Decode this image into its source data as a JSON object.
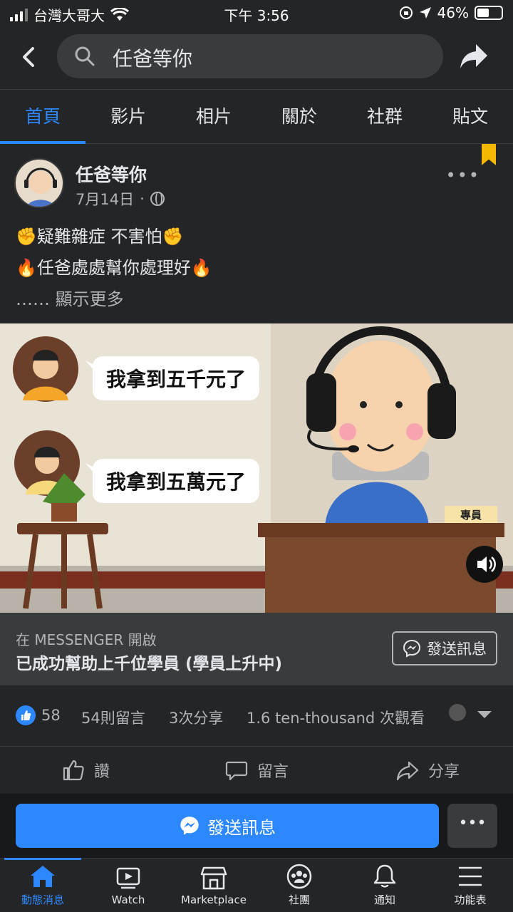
{
  "status_bar": {
    "carrier": "台灣大哥大",
    "time": "下午 3:56",
    "battery": "46%"
  },
  "search": {
    "query": "任爸等你"
  },
  "tabs": [
    {
      "label": "首頁",
      "active": true
    },
    {
      "label": "影片"
    },
    {
      "label": "相片"
    },
    {
      "label": "關於"
    },
    {
      "label": "社群"
    },
    {
      "label": "貼文"
    }
  ],
  "post": {
    "author": "任爸等你",
    "date": "7月14日",
    "date_separator": "·",
    "text_line1": "✊疑難雜症 不害怕✊",
    "text_line2": "🔥任爸處處幫你處理好🔥",
    "see_more": "…… 顯示更多"
  },
  "video": {
    "bubble1": "我拿到五千元了",
    "bubble2": "我拿到五萬元了",
    "desk_sign": "專員"
  },
  "cta": {
    "subtitle": "在 MESSENGER 開啟",
    "title": "已成功幫助上千位學員 (學員上升中)",
    "button": "發送訊息"
  },
  "stats": {
    "likes": "58",
    "comments": "54則留言",
    "shares": "3次分享",
    "views": "1.6 ten-thousand 次觀看"
  },
  "actions": {
    "like": "讚",
    "comment": "留言",
    "share": "分享"
  },
  "message_bar": {
    "button": "發送訊息",
    "more": "•••"
  },
  "bottom_nav": [
    {
      "label": "動態消息",
      "active": true
    },
    {
      "label": "Watch"
    },
    {
      "label": "Marketplace"
    },
    {
      "label": "社團"
    },
    {
      "label": "通知"
    },
    {
      "label": "功能表"
    }
  ],
  "colors": {
    "accent": "#2d88ff",
    "background": "#242526",
    "bookmark": "#f5b800"
  }
}
